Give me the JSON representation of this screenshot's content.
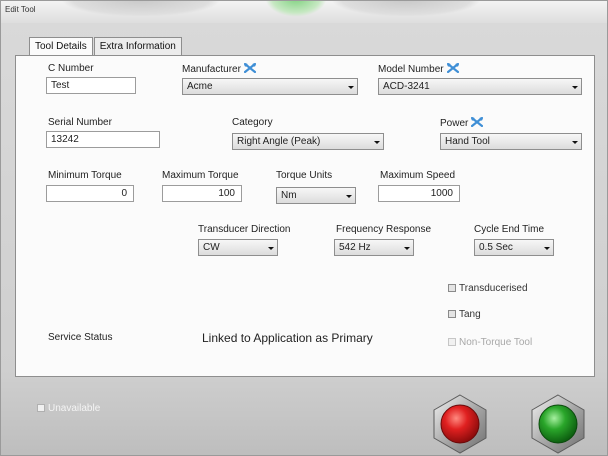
{
  "window": {
    "title": "Edit Tool"
  },
  "tabs": [
    {
      "label": "Tool Details",
      "active": true
    },
    {
      "label": "Extra Information",
      "active": false
    }
  ],
  "fields": {
    "c_number": {
      "label": "C Number",
      "value": "Test"
    },
    "manufacturer": {
      "label": "Manufacturer",
      "value": "Acme"
    },
    "model_number": {
      "label": "Model Number",
      "value": "ACD-3241"
    },
    "serial_number": {
      "label": "Serial Number",
      "value": "13242"
    },
    "category": {
      "label": "Category",
      "value": "Right Angle (Peak)"
    },
    "power": {
      "label": "Power",
      "value": "Hand Tool"
    },
    "min_torque": {
      "label": "Minimum Torque",
      "value": "0"
    },
    "max_torque": {
      "label": "Maximum Torque",
      "value": "100"
    },
    "torque_units": {
      "label": "Torque Units",
      "value": "Nm"
    },
    "max_speed": {
      "label": "Maximum Speed",
      "value": "1000"
    },
    "transducer_direction": {
      "label": "Transducer Direction",
      "value": "CW"
    },
    "frequency_response": {
      "label": "Frequency Response",
      "value": "542 Hz"
    },
    "cycle_end_time": {
      "label": "Cycle End Time",
      "value": "0.5 Sec"
    }
  },
  "checkboxes": {
    "transducerised": {
      "label": "Transducerised",
      "checked": false,
      "enabled": true
    },
    "tang": {
      "label": "Tang",
      "checked": false,
      "enabled": true
    },
    "non_torque_tool": {
      "label": "Non-Torque Tool",
      "checked": false,
      "enabled": false
    },
    "unavailable": {
      "label": "Unavailable",
      "checked": false,
      "enabled": true
    }
  },
  "service": {
    "label": "Service Status",
    "value": "Linked to Application as Primary"
  },
  "icons": {
    "wrench": "wrench-icon",
    "cancel": "cancel-icon",
    "confirm": "confirm-icon"
  },
  "colors": {
    "wrench_icon": "#3f8fd6",
    "cancel_button": "#e02020",
    "confirm_button": "#2aa62a"
  }
}
